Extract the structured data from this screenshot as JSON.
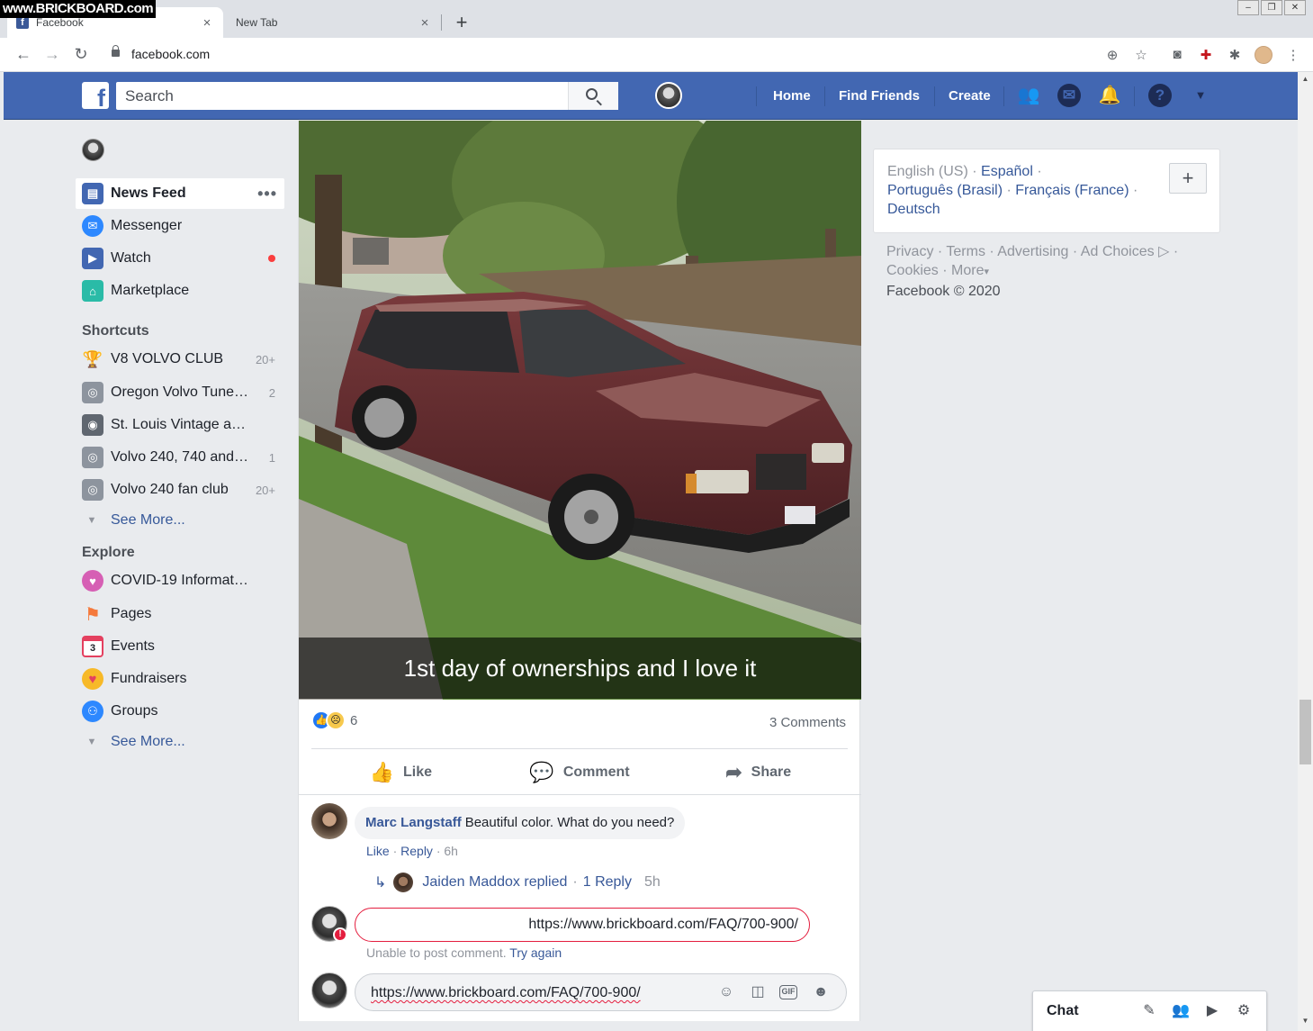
{
  "watermark": "www.BRICKBOARD.com",
  "browser": {
    "tabs": [
      {
        "title": "Facebook",
        "favicon": "f",
        "active": true
      },
      {
        "title": "New Tab",
        "active": false
      }
    ],
    "close_glyph": "×",
    "new_tab_glyph": "+",
    "url": "facebook.com",
    "icons": {
      "back": "←",
      "forward": "→",
      "reload": "↻",
      "zoom": "⊕",
      "star": "☆",
      "ext1": "◙",
      "ext2": "✚",
      "puzzle": "✱",
      "menu": "⋮"
    },
    "window_buttons": [
      "–",
      "❐",
      "✕"
    ]
  },
  "fb_header": {
    "logo": "f",
    "search_placeholder": "Search",
    "nav": [
      "Home",
      "Find Friends",
      "Create"
    ],
    "icons": {
      "friends": "👥",
      "messenger": "✉",
      "notifications": "🔔",
      "help": "?",
      "dropdown": "▼"
    }
  },
  "sidebar": {
    "main_items": [
      {
        "label": "News Feed",
        "icon": "news-feed-icon",
        "color": "#4267b2",
        "glyph": "▤",
        "more": "•••"
      },
      {
        "label": "Messenger",
        "icon": "messenger-icon",
        "color": "#2d88ff",
        "glyph": "✉"
      },
      {
        "label": "Watch",
        "icon": "watch-icon",
        "color": "#4267b2",
        "glyph": "▶"
      },
      {
        "label": "Marketplace",
        "icon": "marketplace-icon",
        "color": "#2abba7",
        "glyph": "⌂"
      }
    ],
    "shortcuts_heading": "Shortcuts",
    "shortcuts": [
      {
        "label": "V8 VOLVO CLUB",
        "count": "20+",
        "icon": "trophy-icon",
        "color": "#c79a2a",
        "glyph": "🏆"
      },
      {
        "label": "Oregon Volvo Tune…",
        "count": "2",
        "icon": "group-icon",
        "color": "#8d949e",
        "glyph": "◎"
      },
      {
        "label": "St. Louis Vintage a…",
        "count": "",
        "icon": "camera-icon",
        "color": "#606770",
        "glyph": "◉"
      },
      {
        "label": "Volvo 240, 740 and…",
        "count": "1",
        "icon": "group-icon",
        "color": "#8d949e",
        "glyph": "◎"
      },
      {
        "label": "Volvo 240 fan club",
        "count": "20+",
        "icon": "group-icon",
        "color": "#8d949e",
        "glyph": "◎"
      }
    ],
    "see_more": "See More...",
    "explore_heading": "Explore",
    "explore": [
      {
        "label": "COVID-19 Informat…",
        "icon": "covid-heart-icon",
        "color": "#d65fb4",
        "glyph": "♥"
      },
      {
        "label": "Pages",
        "icon": "flag-icon",
        "color": "#f5793b",
        "glyph": "⚑"
      },
      {
        "label": "Events",
        "icon": "calendar-icon",
        "color": "#e4405f",
        "glyph": "3"
      },
      {
        "label": "Fundraisers",
        "icon": "fundraiser-heart-icon",
        "color": "#f7b928",
        "glyph": "♥"
      },
      {
        "label": "Groups",
        "icon": "groups-icon",
        "color": "#2d88ff",
        "glyph": "⚇"
      }
    ],
    "see_more_2": "See More..."
  },
  "post": {
    "caption": "1st day of ownerships and I love it",
    "reaction_count": "6",
    "reaction_glyphs": {
      "like": "👍",
      "sad": "☹"
    },
    "comment_count": "3 Comments",
    "actions": [
      {
        "label": "Like",
        "glyph": "👍"
      },
      {
        "label": "Comment",
        "glyph": "💬"
      },
      {
        "label": "Share",
        "glyph": "➦"
      }
    ],
    "comment": {
      "author": "Marc Langstaff",
      "text": "Beautiful color. What do you need?",
      "like": "Like",
      "reply": "Reply",
      "time": "6h",
      "sep": "·"
    },
    "reply_summary": {
      "arrow": "↳",
      "name": "Jaiden Maddox replied",
      "sep": "·",
      "count": "1 Reply",
      "time": "5h"
    },
    "failed_comment": {
      "text": "https://www.brickboard.com/FAQ/700-900/",
      "badge": "!",
      "error": "Unable to post comment.",
      "retry": "Try again"
    },
    "composer": {
      "text": "https://www.brickboard.com/FAQ/700-900/",
      "icons": {
        "emoji": "☺",
        "camera": "◫",
        "gif": "GIF",
        "sticker": "☻"
      }
    }
  },
  "right": {
    "languages": {
      "current": "English (US)",
      "others": [
        "Español",
        "Português (Brasil)",
        "Français (France)",
        "Deutsch"
      ],
      "sep": "·",
      "add": "+"
    },
    "footer": {
      "links": [
        "Privacy",
        "Terms",
        "Advertising",
        "Ad Choices"
      ],
      "adchoices_glyph": "▷",
      "cookies": "Cookies",
      "more": "More",
      "more_glyph": "▾",
      "copyright": "Facebook © 2020",
      "sep": "·"
    }
  },
  "chat": {
    "label": "Chat",
    "icons": {
      "compose": "✎",
      "group": "👥",
      "video": "▶",
      "settings": "⚙"
    }
  }
}
